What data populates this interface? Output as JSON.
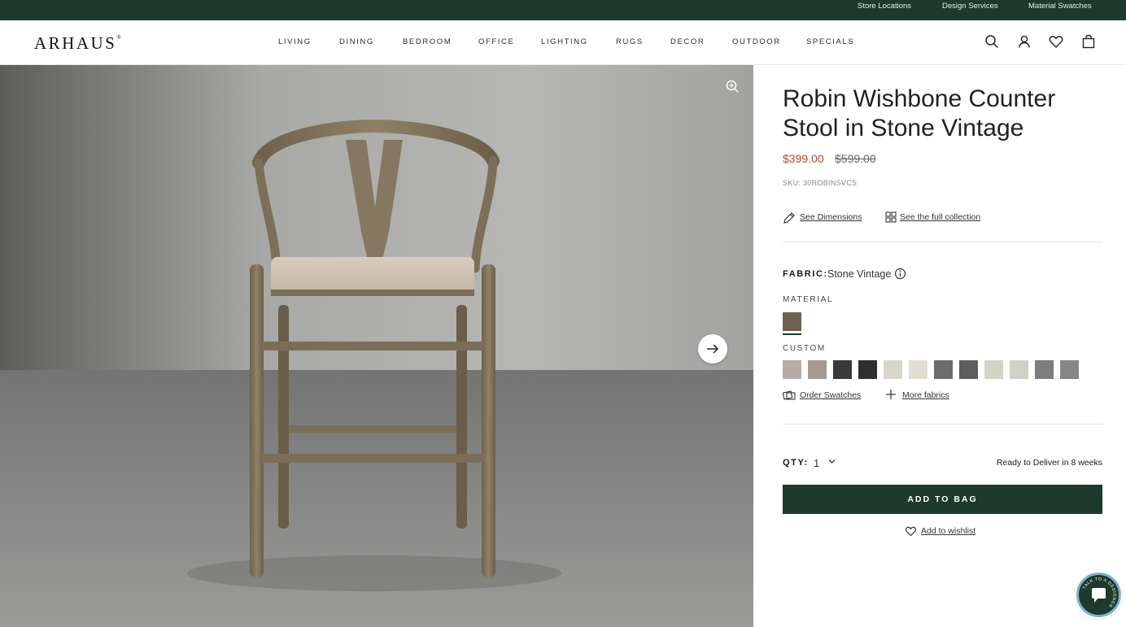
{
  "topbar": {
    "store_locations": "Store Locations",
    "design_services": "Design Services",
    "material_swatches": "Material Swatches"
  },
  "header": {
    "logo": "ARHAUS",
    "logo_mark": "®",
    "nav": [
      "LIVING",
      "DINING",
      "BEDROOM",
      "OFFICE",
      "LIGHTING",
      "RUGS",
      "DECOR",
      "OUTDOOR",
      "SPECIALS"
    ],
    "icons": [
      "search-icon",
      "account-icon",
      "wishlist-heart-icon",
      "shopping-bag-icon"
    ]
  },
  "hero": {
    "icons": [
      "zoom-icon",
      "arrow-right-icon"
    ]
  },
  "product": {
    "title": "Robin Wishbone Counter Stool in Stone Vintage",
    "price": "$399.00",
    "original_price": "$599.00",
    "sku": "SKU: 30ROBINSVCS",
    "see_dimensions": "See Dimensions",
    "see_collection": "See the full collection",
    "fabric_label": "FABRIC:",
    "fabric_value": "Stone Vintage",
    "material_label": "MATERIAL",
    "material_swatch_color": "#6f6350",
    "custom_label": "CUSTOM",
    "custom_swatch_colors": [
      "#b8aaa4",
      "#a89892",
      "#3a3a38",
      "#2e302d",
      "#d8d6cb",
      "#e0ded2",
      "#6b6d6c",
      "#5c5e5f",
      "#d2d3c9",
      "#cfd1c6",
      "#7c7d7d",
      "#858686"
    ],
    "order_swatches": "Order Swatches",
    "more_fabrics": "More fabrics",
    "qty_label": "QTY:",
    "qty_value": "1",
    "delivery": "Ready to Deliver in 8 weeks",
    "add_to_bag": "ADD TO BAG",
    "add_to_wishlist": "Add to wishlist"
  },
  "chat_widget": {
    "label": "TALK TO A DESIGNER",
    "icon": "chat-bubble-icon"
  },
  "colors": {
    "brand_green": "#1d3a2c",
    "sale_red": "#b4492c"
  }
}
